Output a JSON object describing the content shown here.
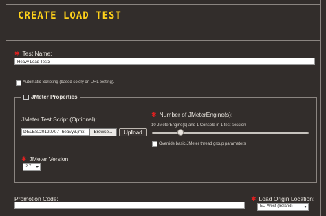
{
  "header": {
    "title": "CREATE LOAD TEST"
  },
  "test_name": {
    "label": "Test Name:",
    "value": "Heavy Load Test3"
  },
  "auto_scripting": {
    "label": "Automatic Scripting (based solely on URL testing).",
    "checked": false
  },
  "jmeter": {
    "legend": "JMeter Properties",
    "script_label": "JMeter Test Script (Optional):",
    "script_value": "DELES/20120707_heavy3.jmx",
    "browse_label": "Browse...",
    "upload_label": "Upload",
    "engines_label": "Number of JMeterEngine(s):",
    "engines_info": "10 JMeterEngine(s) and 1 Console in 1 test session",
    "engines_slider_fraction": 0.17,
    "override_label": "Override basic JMeter thread group parameters",
    "override_checked": false,
    "version_label": "JMeter Version:",
    "version_value": "2.7"
  },
  "promotion": {
    "label": "Promotion Code:",
    "value": ""
  },
  "load_origin": {
    "label": "Load Origin Location:",
    "value": "EU West (Ireland)"
  },
  "colors": {
    "accent": "#ffd21a",
    "required": "#e02020",
    "background": "#322d2b"
  }
}
